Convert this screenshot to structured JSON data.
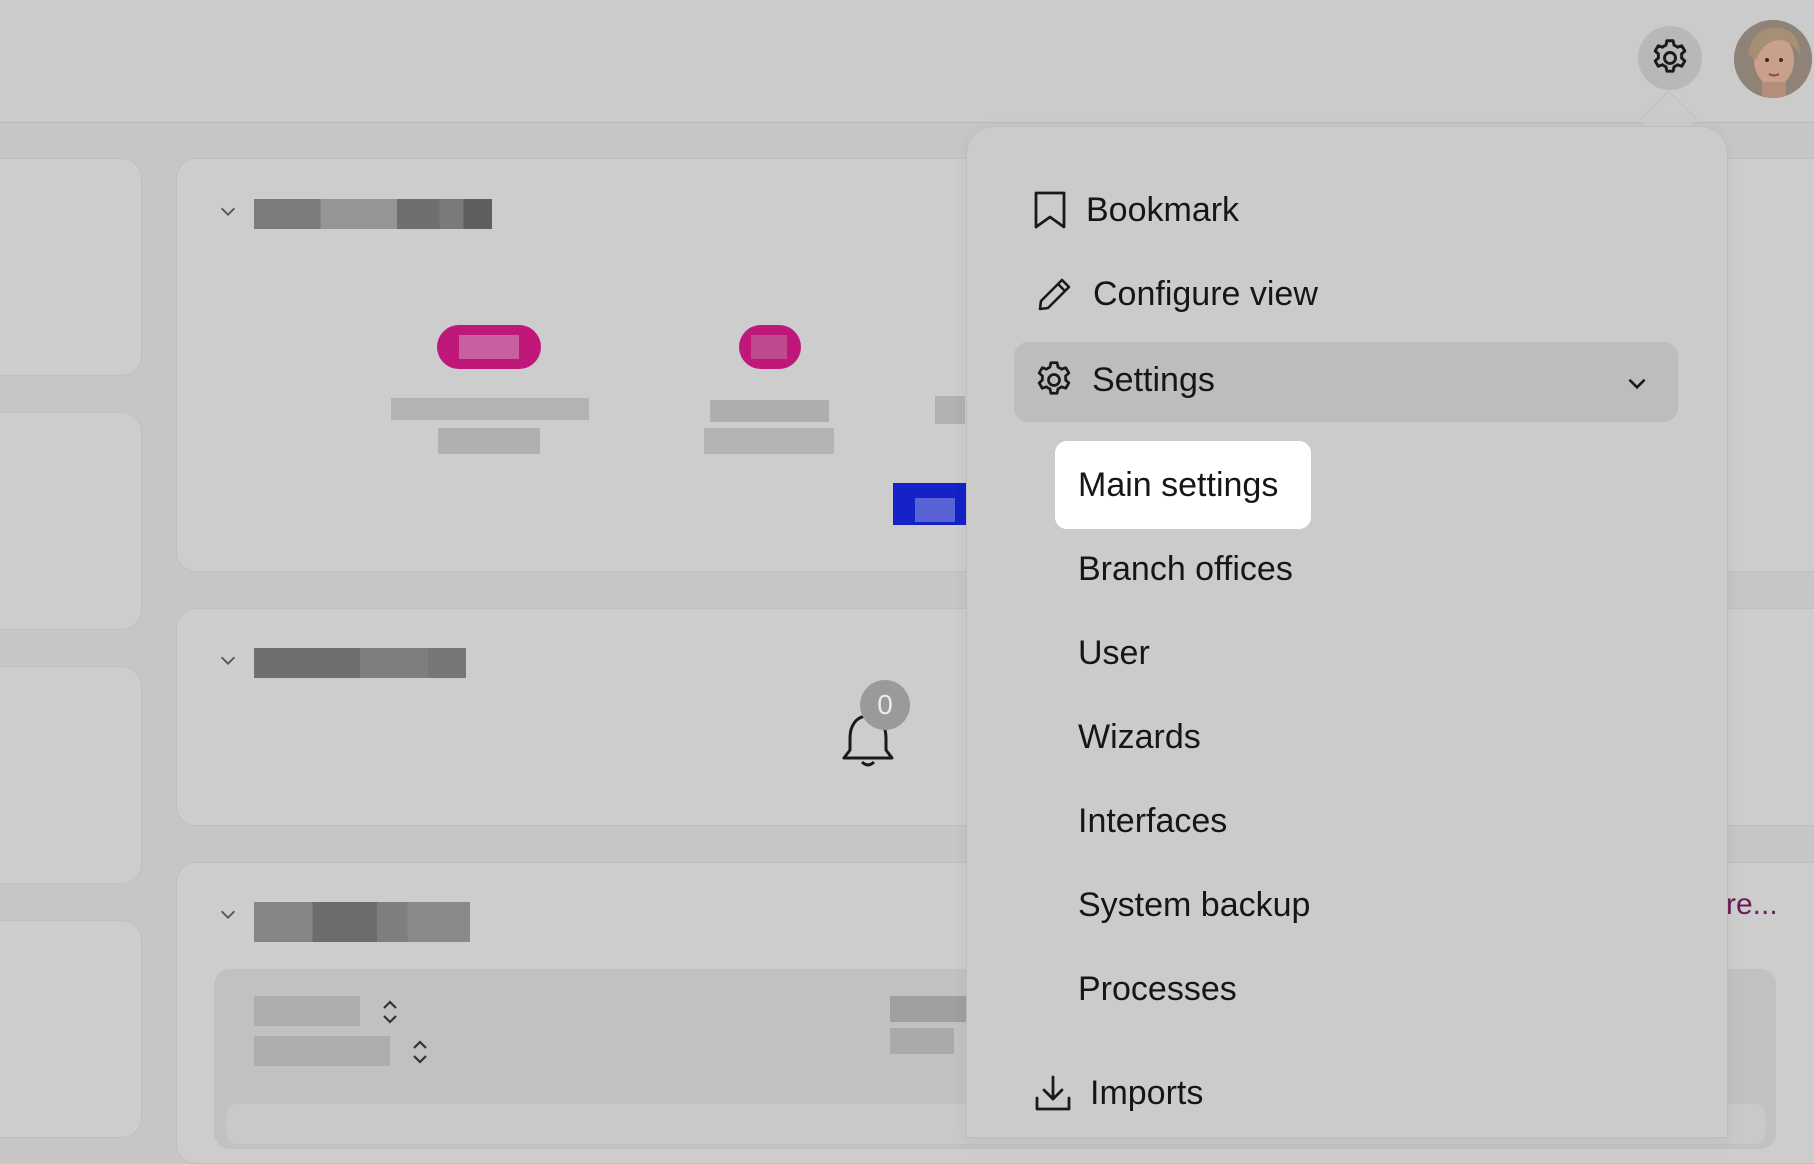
{
  "menu": {
    "bookmark_label": "Bookmark",
    "configure_view_label": "Configure view",
    "settings_label": "Settings",
    "settings_items": [
      {
        "label": "Main settings"
      },
      {
        "label": "Branch offices"
      },
      {
        "label": "User"
      },
      {
        "label": "Wizards"
      },
      {
        "label": "Interfaces"
      },
      {
        "label": "System backup"
      },
      {
        "label": "Processes"
      }
    ],
    "imports_label": "Imports"
  },
  "notifications": {
    "count": "0"
  },
  "more_link_text": "re...",
  "colors": {
    "accent_magenta": "#c0187a",
    "accent_blue": "#1521c9",
    "link_purple": "#6b1b55",
    "overlay_gray": "#c6c6c7",
    "active_item_bg": "#ffffff"
  },
  "icons": {
    "header_settings": "gear-icon",
    "bookmark": "bookmark-icon",
    "configure_view": "pencil-icon",
    "settings": "gear-icon",
    "settings_toggle": "chevron-down-icon",
    "imports": "download-icon",
    "notifications": "bell-icon",
    "section_toggle": "chevron-down-icon",
    "sort": "sort-icon"
  }
}
